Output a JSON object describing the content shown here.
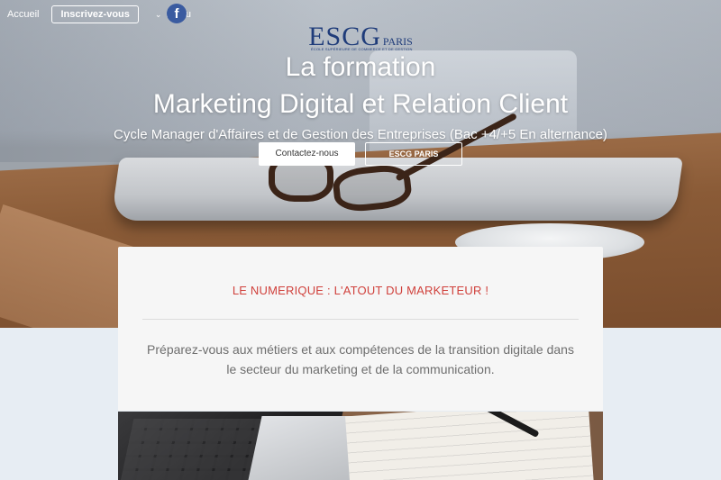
{
  "nav": {
    "home_label": "Accueil",
    "register_label": "Inscrivez-vous",
    "menu_label": "Menu",
    "facebook_icon": "facebook-icon"
  },
  "logo": {
    "name": "ESCG",
    "city": "PARIS",
    "tagline": "ÉCOLE SUPÉRIEURE DE COMMERCE ET DE GESTION"
  },
  "hero": {
    "title_line1": "La formation",
    "title_line2": "Marketing Digital et Relation Client",
    "subtitle": "Cycle Manager d'Affaires et de Gestion des Entreprises (Bac +4/+5 En alternance)",
    "contact_button": "Contactez-nous",
    "escg_button": "ESCG PARIS"
  },
  "card": {
    "heading": "LE NUMERIQUE : L'ATOUT DU MARKETEUR !",
    "body": "Préparez-vous aux métiers et aux compétences de la transition digitale dans le secteur du marketing et de la communication."
  },
  "colors": {
    "accent_red": "#d0413c",
    "logo_blue": "#1f3c7a",
    "facebook_blue": "#3a5ba0",
    "page_bg": "#e7edf3",
    "card_bg": "#f6f6f6"
  }
}
